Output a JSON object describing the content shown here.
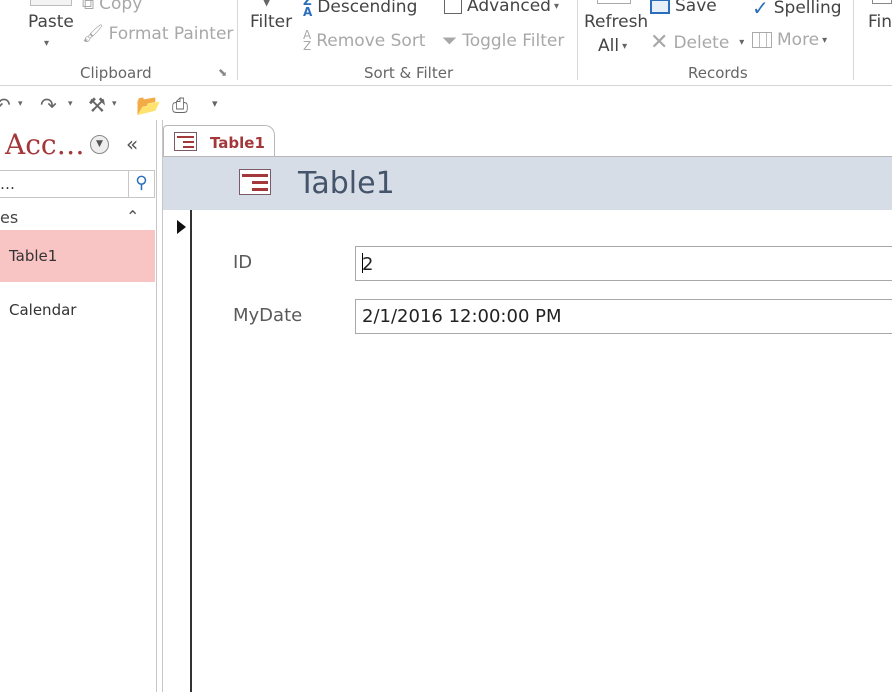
{
  "ribbon": {
    "paste": "Paste",
    "copy": "Copy",
    "format_painter": "Format Painter",
    "clipboard_group": "Clipboard",
    "filter": "Filter",
    "descending": "Descending",
    "remove_sort": "Remove Sort",
    "advanced": "Advanced",
    "toggle_filter": "Toggle Filter",
    "sort_filter_group": "Sort & Filter",
    "refresh_all_1": "Refresh",
    "refresh_all_2": "All",
    "save": "Save",
    "delete": "Delete",
    "spelling": "Spelling",
    "more": "More",
    "records_group": "Records",
    "find": "Fin"
  },
  "nav": {
    "title": "Acc…",
    "search_value": "…",
    "group_label": "es",
    "items": [
      {
        "label": "Table1",
        "selected": true
      },
      {
        "label": "Calendar",
        "selected": false
      }
    ]
  },
  "document": {
    "tab_label": "Table1",
    "form_title": "Table1",
    "fields": [
      {
        "label": "ID",
        "value": "2"
      },
      {
        "label": "MyDate",
        "value": "2/1/2016 12:00:00 PM"
      }
    ]
  },
  "colors": {
    "accent": "#a4373a",
    "selected_item": "#f9c4c4",
    "form_header": "#d7dde7"
  }
}
